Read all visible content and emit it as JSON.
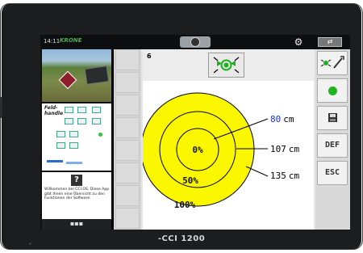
{
  "status": {
    "time": "14:11",
    "brand": "KRONE",
    "camera_icon": "camera-icon",
    "settings_icon": "gear-icon",
    "swap_icon": "swap-screens-icon"
  },
  "sidebar": {
    "help_text": "Willkommen bei CCI.OS. Diese App gibt Ihnen eine Übersicht zu den Funktionen der Software.",
    "help_icon_glyph": "?",
    "handbook_title": "Feld-\nhandle",
    "more_label": "▪▪▪"
  },
  "mask": {
    "number": "6",
    "mode_icon": "sensor-contraction-icon"
  },
  "chart_data": {
    "type": "concentric-circles",
    "circles": [
      {
        "percent_label": "0%",
        "distance_label": "80",
        "unit": "cm"
      },
      {
        "percent_label": "50%",
        "distance_label": "107",
        "unit": "cm"
      },
      {
        "percent_label": "100%",
        "distance_label": "135",
        "unit": "cm"
      }
    ],
    "fill_color": "#fbf700",
    "highlight_color": "#1a33d6"
  },
  "softkeys": {
    "sensor_icon": "sensor-toggle-icon",
    "status_icon": "green-dot-icon",
    "save_icon": "save-icon",
    "def_label": "DEF",
    "esc_label": "ESC"
  },
  "device": {
    "model": "-CCI 1200"
  },
  "colors": {
    "accent_green": "#21b421",
    "brand_green": "#4caf50"
  }
}
